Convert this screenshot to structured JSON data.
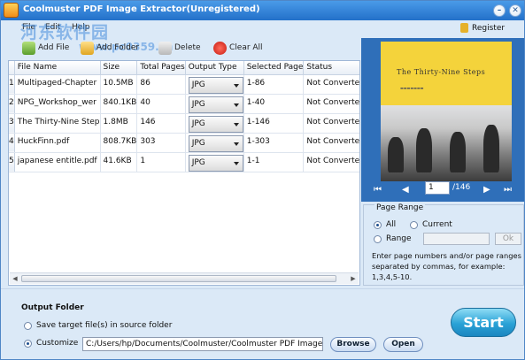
{
  "window": {
    "title": "Coolmuster PDF Image Extractor(Unregistered)",
    "minimize_glyph": "–",
    "close_glyph": "✕"
  },
  "menu": {
    "items": [
      {
        "label": "File"
      },
      {
        "label": "Edit"
      },
      {
        "label": "Help"
      }
    ]
  },
  "watermark": {
    "line1": "河东软件园",
    "line2": "www.pc0359.cn"
  },
  "register": {
    "label": "Register"
  },
  "toolbar": {
    "add_file": "Add File",
    "add_folder": "Add Folder",
    "delete": "Delete",
    "clear_all": "Clear All"
  },
  "table": {
    "headers": [
      "File Name",
      "Size",
      "Total Pages",
      "Output Type",
      "Selected Page",
      "Status"
    ],
    "rows": [
      {
        "num": "1",
        "name": "Multipaged-Chapter",
        "size": "10.5MB",
        "pages": "86",
        "type": "JPG",
        "selected": "1-86",
        "status": "Not Converted"
      },
      {
        "num": "2",
        "name": "NPG_Workshop_wer",
        "size": "840.1KB",
        "pages": "40",
        "type": "JPG",
        "selected": "1-40",
        "status": "Not Converted"
      },
      {
        "num": "3",
        "name": "The Thirty-Nine Step",
        "size": "1.8MB",
        "pages": "146",
        "type": "JPG",
        "selected": "1-146",
        "status": "Not Converted"
      },
      {
        "num": "4",
        "name": "HuckFinn.pdf",
        "size": "808.7KB",
        "pages": "303",
        "type": "JPG",
        "selected": "1-303",
        "status": "Not Converted"
      },
      {
        "num": "5",
        "name": "japanese entitle.pdf",
        "size": "41.6KB",
        "pages": "1",
        "type": "JPG",
        "selected": "1-1",
        "status": "Not Converted"
      }
    ]
  },
  "preview": {
    "book_title": "The Thirty-Nine Steps",
    "current_page": "1",
    "total_pages": "/146",
    "first_glyph": "⏮",
    "prev_glyph": "◀",
    "next_glyph": "▶",
    "last_glyph": "⏭"
  },
  "page_range": {
    "legend": "Page Range",
    "all": "All",
    "current": "Current",
    "range": "Range",
    "range_value": "",
    "ok": "Ok",
    "hint": "Enter page numbers and/or page ranges separated by commas, for example: 1,3,4,5-10."
  },
  "output": {
    "title": "Output Folder",
    "source_option": "Save target file(s) in source folder",
    "customize_option": "Customize",
    "path": "C:/Users/hp/Documents/Coolmuster/Coolmuster PDF Image Ex",
    "browse": "Browse",
    "open": "Open",
    "start": "Start"
  },
  "colors": {
    "titlebar": "#2f82d8",
    "preview_bg": "#2f6fb9",
    "book": "#f4d33b",
    "start": "#2aa2d6"
  }
}
